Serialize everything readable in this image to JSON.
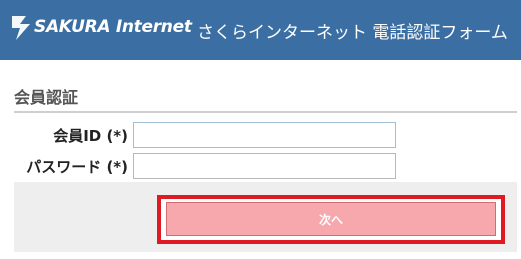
{
  "header": {
    "logo_text": "SAKURA Internet",
    "title": "さくらインターネット 電話認証フォーム",
    "logo_icon": "sakura-logo-icon"
  },
  "form": {
    "section_title": "会員認証",
    "member_id_label": "会員ID (*)",
    "member_id_value": "",
    "password_label": "パスワード (*)",
    "password_value": "",
    "next_label": "次へ"
  },
  "colors": {
    "header_bg": "#3b6ea3",
    "button_bg": "#f7a8ad",
    "highlight": "#e01a22"
  }
}
